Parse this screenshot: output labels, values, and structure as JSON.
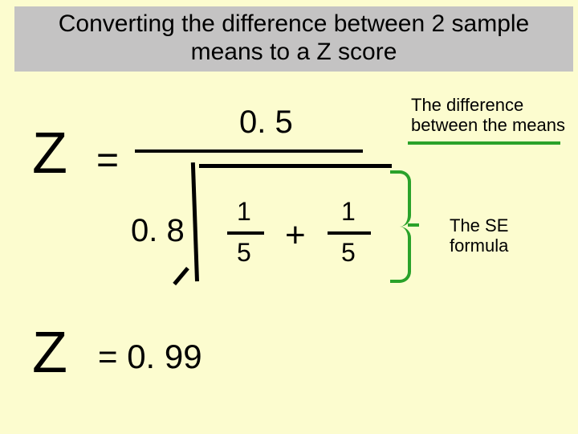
{
  "title": "Converting the difference between 2 sample means to a Z score",
  "formula": {
    "lhs_symbol": "Z",
    "equals": "=",
    "numerator": "0. 5",
    "coef_outside_radical": "0. 8",
    "frac1_num": "1",
    "frac1_den": "5",
    "plus": "+",
    "frac2_num": "1",
    "frac2_den": "5"
  },
  "result": {
    "lhs_symbol": "Z",
    "rhs": "= 0. 99"
  },
  "annotations": {
    "difference": "The difference between the means",
    "se": "The SE formula"
  }
}
